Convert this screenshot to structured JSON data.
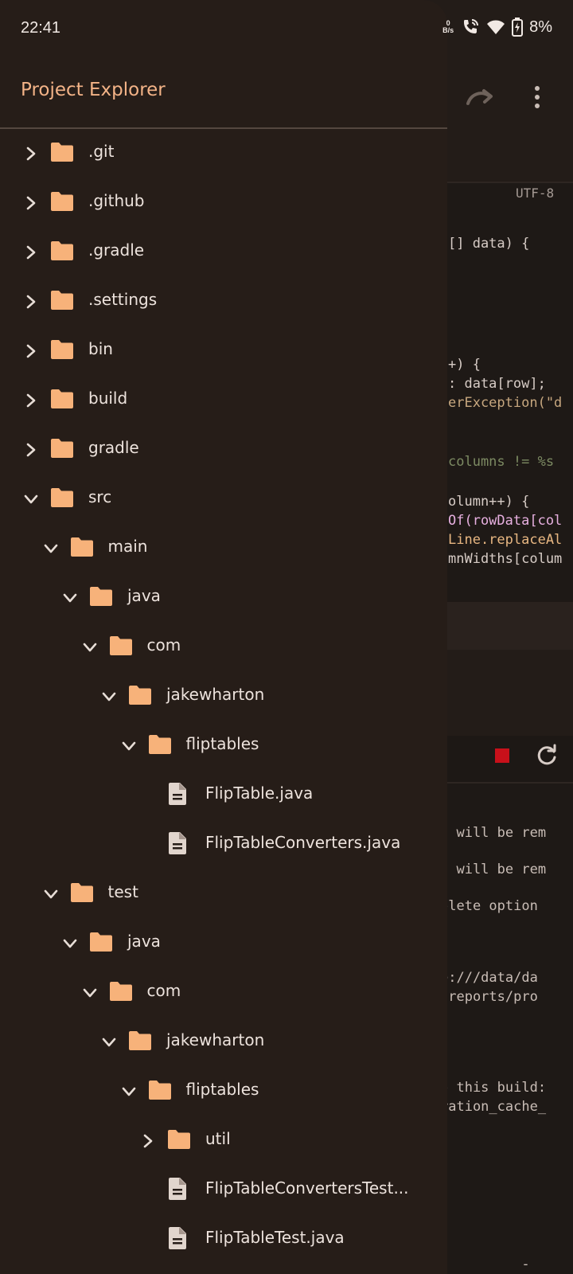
{
  "status_bar": {
    "time": "22:41",
    "net_speed_top": "0",
    "net_speed_bottom": "B/s",
    "battery": "8%"
  },
  "drawer": {
    "title": "Project Explorer",
    "items": [
      {
        "label": ".git",
        "depth": 0,
        "kind": "folder",
        "expanded": false
      },
      {
        "label": ".github",
        "depth": 0,
        "kind": "folder",
        "expanded": false
      },
      {
        "label": ".gradle",
        "depth": 0,
        "kind": "folder",
        "expanded": false
      },
      {
        "label": ".settings",
        "depth": 0,
        "kind": "folder",
        "expanded": false
      },
      {
        "label": "bin",
        "depth": 0,
        "kind": "folder",
        "expanded": false
      },
      {
        "label": "build",
        "depth": 0,
        "kind": "folder",
        "expanded": false
      },
      {
        "label": "gradle",
        "depth": 0,
        "kind": "folder",
        "expanded": false
      },
      {
        "label": "src",
        "depth": 0,
        "kind": "folder",
        "expanded": true
      },
      {
        "label": "main",
        "depth": 1,
        "kind": "folder",
        "expanded": true
      },
      {
        "label": "java",
        "depth": 2,
        "kind": "folder",
        "expanded": true
      },
      {
        "label": "com",
        "depth": 3,
        "kind": "folder",
        "expanded": true
      },
      {
        "label": "jakewharton",
        "depth": 4,
        "kind": "folder",
        "expanded": true
      },
      {
        "label": "fliptables",
        "depth": 5,
        "kind": "folder",
        "expanded": true
      },
      {
        "label": "FlipTable.java",
        "depth": 6,
        "kind": "file"
      },
      {
        "label": "FlipTableConverters.java",
        "depth": 6,
        "kind": "file"
      },
      {
        "label": "test",
        "depth": 1,
        "kind": "folder",
        "expanded": true
      },
      {
        "label": "java",
        "depth": 2,
        "kind": "folder",
        "expanded": true
      },
      {
        "label": "com",
        "depth": 3,
        "kind": "folder",
        "expanded": true
      },
      {
        "label": "jakewharton",
        "depth": 4,
        "kind": "folder",
        "expanded": true
      },
      {
        "label": "fliptables",
        "depth": 5,
        "kind": "folder",
        "expanded": true
      },
      {
        "label": "util",
        "depth": 6,
        "kind": "folder",
        "expanded": false
      },
      {
        "label": "FlipTableConvertersTest...",
        "depth": 6,
        "kind": "file"
      },
      {
        "label": "FlipTableTest.java",
        "depth": 6,
        "kind": "file"
      }
    ]
  },
  "editor": {
    "encoding": "UTF-8",
    "code_lines": [
      {
        "text": "[] data) {",
        "cls": ""
      },
      {
        "text": "+) {",
        "cls": ""
      },
      {
        "text": ": data[row];",
        "cls": ""
      },
      {
        "text": "erException(\"d",
        "cls": "c-str"
      },
      {
        "text": "columns != %s",
        "cls": "c-comment"
      },
      {
        "text": "olumn++) {",
        "cls": ""
      },
      {
        "text": "Of(rowData[col",
        "cls": "c-fn"
      },
      {
        "text": "Line.replaceAl",
        "cls": "c-type"
      },
      {
        "text": "mnWidths[colum",
        "cls": ""
      }
    ],
    "console_lines": [
      "] will be rem",
      "] will be rem",
      "olete option",
      "e:///data/da",
      "/reports/pro",
      "o this build:",
      "ration_cache_",
      "/         -"
    ]
  },
  "colors": {
    "accent": "#f3b387",
    "folder": "#f7b27a",
    "drawer_bg": "#261d18",
    "stop": "#c8101a"
  }
}
